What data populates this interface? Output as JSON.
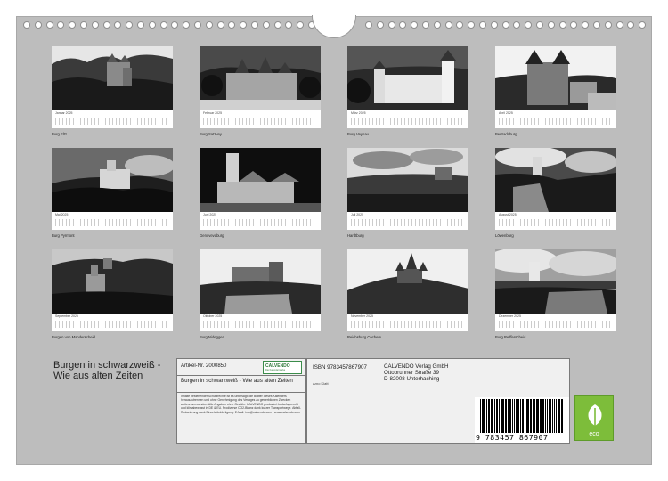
{
  "thumbnails": [
    {
      "month": "Januar 2025",
      "caption": "Burg Eltz"
    },
    {
      "month": "Februar 2025",
      "caption": "Burg Satzvey"
    },
    {
      "month": "März 2025",
      "caption": "Burg Veynau"
    },
    {
      "month": "April 2025",
      "caption": "Bertradaburg"
    },
    {
      "month": "Mai 2025",
      "caption": "Burg Pyrmont"
    },
    {
      "month": "Juni 2025",
      "caption": "Genovevaburg"
    },
    {
      "month": "Juli 2025",
      "caption": "Hardtburg"
    },
    {
      "month": "August 2025",
      "caption": "Löwenburg"
    },
    {
      "month": "September 2025",
      "caption": "Burgen von Manderscheid"
    },
    {
      "month": "Oktober 2025",
      "caption": "Burg Nideggen"
    },
    {
      "month": "November 2025",
      "caption": "Reichsburg Cochem"
    },
    {
      "month": "Dezember 2025",
      "caption": "Burg Reifferscheid"
    }
  ],
  "back": {
    "title": "Burgen in schwarzweiß - Wie aus alten Zeiten",
    "article_no": "Artikel-Nr. 2000850",
    "logo_text": "CALVENDO",
    "logo_sub": "Die Kalendermarke",
    "info_title": "Burgen in schwarzweiß - Wie aus alten Zeiten",
    "legal": "Inhalte bestehender Schutzrechte ist es untersagt, die Blätter dieses Kalenders herauszutrennen und ohne Genehmigung des Verlages zu gewerblichen Zwecken weiterzuverwenden. Alle Angaben ohne Gewähr. CALVENDO produziert bedarfsgerecht und klimabewusst in DE & EU. Prodiverse CO2-Bilanz dank kurzer Transportwege. Abfall-Reduzierung dank Einzelstückfertigung. E-Mail: info@calvendo.com · www.calvendo.com",
    "isbn": "ISBN 9783457867907",
    "publisher": "CALVENDO Verlag GmbH\nOttobrunner Straße 39\nD-82008 Unterhaching",
    "author": "Arno Klatt",
    "barcode_number": "9 783457 867907",
    "eco_label": "eco"
  }
}
